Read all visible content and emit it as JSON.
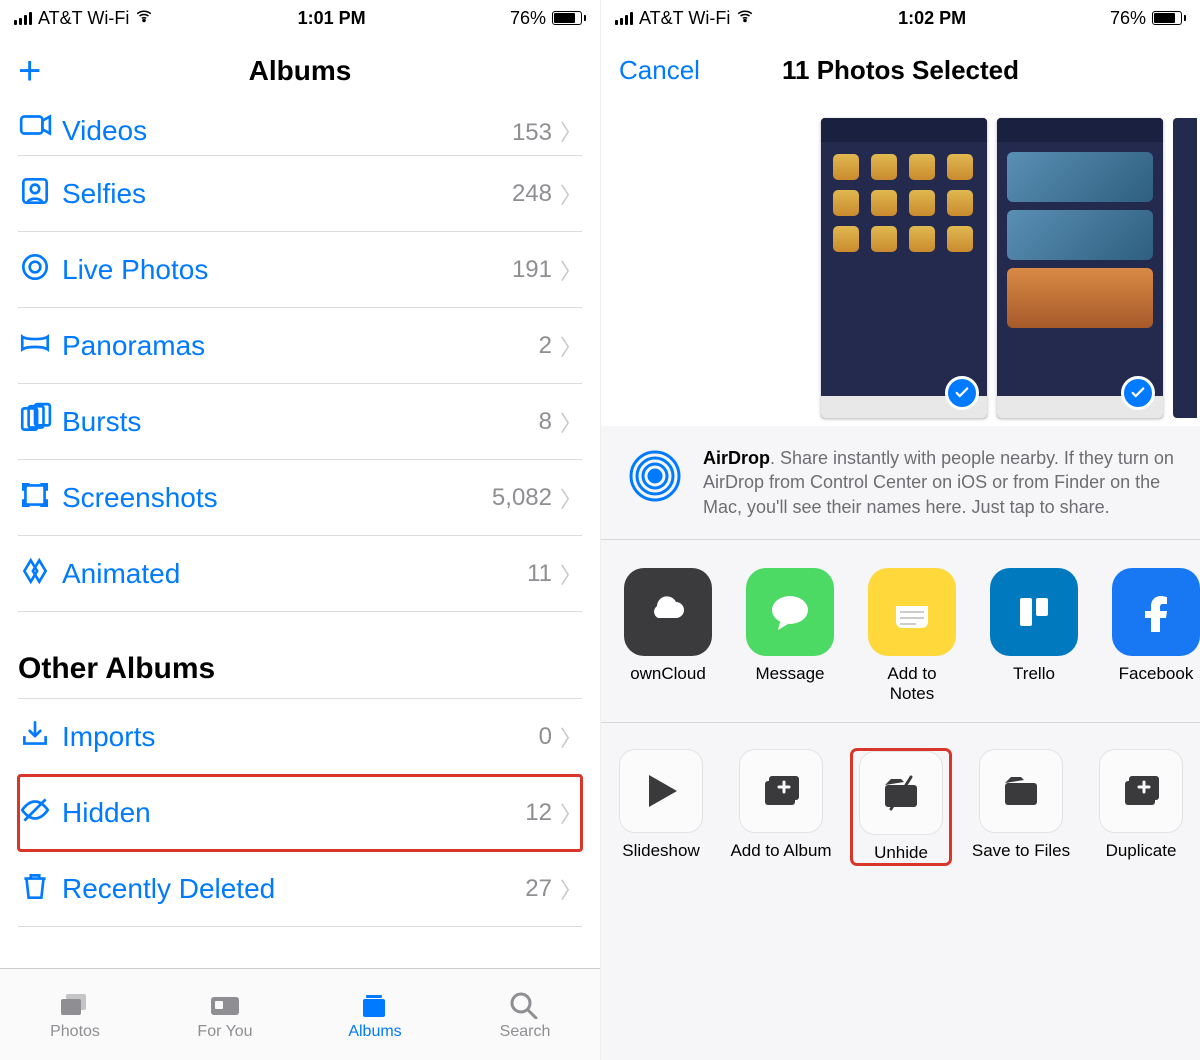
{
  "left": {
    "status": {
      "carrier": "AT&T Wi-Fi",
      "time": "1:01 PM",
      "battery": "76%"
    },
    "nav": {
      "title": "Albums",
      "add": "+"
    },
    "albums": [
      {
        "icon": "video",
        "name": "Videos",
        "count": "153"
      },
      {
        "icon": "selfie",
        "name": "Selfies",
        "count": "248"
      },
      {
        "icon": "live",
        "name": "Live Photos",
        "count": "191"
      },
      {
        "icon": "pano",
        "name": "Panoramas",
        "count": "2"
      },
      {
        "icon": "burst",
        "name": "Bursts",
        "count": "8"
      },
      {
        "icon": "screenshot",
        "name": "Screenshots",
        "count": "5,082"
      },
      {
        "icon": "animated",
        "name": "Animated",
        "count": "11"
      }
    ],
    "other_title": "Other Albums",
    "other": [
      {
        "icon": "imports",
        "name": "Imports",
        "count": "0"
      },
      {
        "icon": "hidden",
        "name": "Hidden",
        "count": "12",
        "hl": true
      },
      {
        "icon": "deleted",
        "name": "Recently Deleted",
        "count": "27"
      }
    ],
    "tabs": [
      {
        "name": "Photos"
      },
      {
        "name": "For You"
      },
      {
        "name": "Albums",
        "active": true
      },
      {
        "name": "Search"
      }
    ]
  },
  "right": {
    "status": {
      "carrier": "AT&T Wi-Fi",
      "time": "1:02 PM",
      "battery": "76%"
    },
    "nav": {
      "cancel": "Cancel",
      "title": "11 Photos Selected"
    },
    "airdrop": {
      "title": "AirDrop",
      "body": ". Share instantly with people nearby. If they turn on AirDrop from Control Center on iOS or from Finder on the Mac, you'll see their names here. Just tap to share."
    },
    "apps": [
      {
        "name": "ownCloud",
        "color": "#3b3b3d",
        "icon": "cloud"
      },
      {
        "name": "Message",
        "color": "#4cd964",
        "icon": "bubble"
      },
      {
        "name": "Add to Notes",
        "color": "#ffd93b",
        "icon": "notes"
      },
      {
        "name": "Trello",
        "color": "#0079bf",
        "icon": "trello"
      },
      {
        "name": "Facebook",
        "color": "#1877f2",
        "icon": "fb"
      }
    ],
    "actions": [
      {
        "name": "Slideshow",
        "icon": "play"
      },
      {
        "name": "Add to Album",
        "icon": "albumplus"
      },
      {
        "name": "Unhide",
        "icon": "unhide",
        "hl": true
      },
      {
        "name": "Save to Files",
        "icon": "folder"
      },
      {
        "name": "Duplicate",
        "icon": "dup"
      }
    ]
  }
}
